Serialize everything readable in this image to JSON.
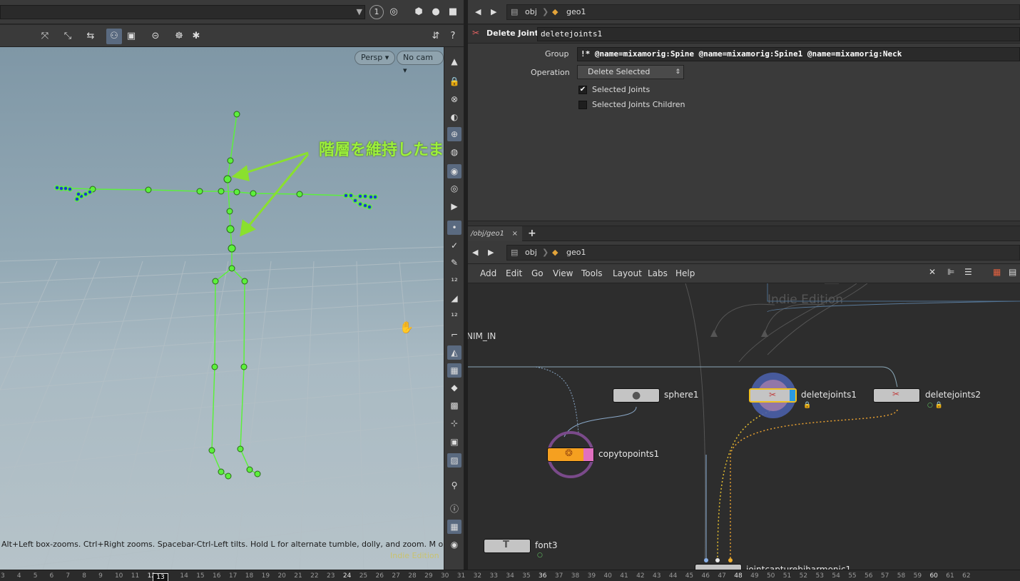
{
  "left_top": {
    "circle_num": "1"
  },
  "viewport": {
    "persp_label": "Persp ▾",
    "cam_label": "No cam ▾",
    "status": "Alt+Left box-zooms. Ctrl+Right zooms. Spacebar-Ctrl-Left tilts. Hold L for alternate tumble, dolly, and zoom. M or Alt+M for",
    "watermark": "Indie Edition"
  },
  "annotation": "階層を維持したままジョイントを削除できている",
  "param_nav": {
    "crumb1": "obj",
    "crumb2": "geo1"
  },
  "param_header": {
    "node_type": "Delete Joints",
    "node_name": "deletejoints1"
  },
  "params": {
    "group_label": "Group",
    "group_value": "!* @name=mixamorig:Spine @name=mixamorig:Spine1 @name=mixamorig:Neck",
    "operation_label": "Operation",
    "operation_value": "Delete Selected",
    "check1_label": "Selected Joints",
    "check2_label": "Selected Joints Children"
  },
  "network": {
    "tab_label": "/obj/geo1",
    "tab_close": "×",
    "tab_add": "+",
    "crumb1": "obj",
    "crumb2": "geo1",
    "menu": [
      "Add",
      "Edit",
      "Go",
      "View",
      "Tools",
      "Layout",
      "Labs",
      "Help"
    ],
    "watermark": "Indie Edition",
    "anim_in": "NIM_IN",
    "nodes": {
      "sphere": "sphere1",
      "delete1": "deletejoints1",
      "delete2": "deletejoints2",
      "copy": "copytopoints1",
      "font": "font3",
      "capture": "jointcapturebiharmonic1"
    }
  },
  "timeline": {
    "current_frame": "13",
    "ticks": [
      "3",
      "4",
      "5",
      "6",
      "7",
      "8",
      "9",
      "10",
      "11",
      "12",
      "13",
      "14",
      "15",
      "16",
      "17",
      "18",
      "19",
      "20",
      "21",
      "22",
      "23",
      "24",
      "25",
      "26",
      "27",
      "28",
      "29",
      "30",
      "31",
      "32",
      "33",
      "34",
      "35",
      "36",
      "37",
      "38",
      "39",
      "40",
      "41",
      "42",
      "43",
      "44",
      "45",
      "46",
      "47",
      "48",
      "49",
      "50",
      "51",
      "52",
      "53",
      "54",
      "55",
      "56",
      "57",
      "58",
      "59",
      "60",
      "61",
      "62"
    ]
  },
  "colors": {
    "skeleton": "#5cf03c",
    "annotation": "#9cf03a",
    "selected_node": "#f0c020",
    "copy_node": "#f0a020"
  }
}
